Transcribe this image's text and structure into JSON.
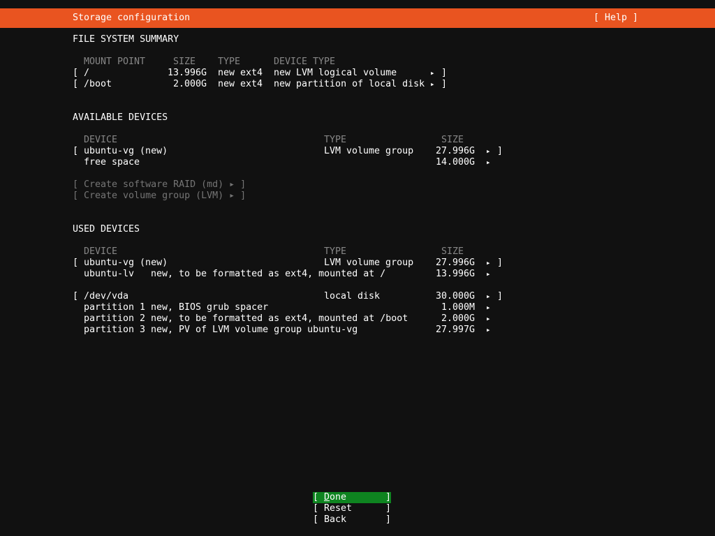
{
  "glyphs": {
    "open_bracket": "[",
    "close_bracket": "]",
    "arrow": "▸"
  },
  "colors": {
    "accent_orange": "#E95420",
    "focus_green": "#0E8420",
    "background": "#111111",
    "muted_gray": "#878787"
  },
  "header": {
    "title": "Storage configuration",
    "help_label": "[ Help ]"
  },
  "fs": {
    "title": "FILE SYSTEM SUMMARY",
    "columns": [
      "MOUNT POINT",
      "SIZE",
      "TYPE",
      "DEVICE TYPE"
    ],
    "rows": [
      {
        "mount_point": "/",
        "size": "13.996G",
        "type": "new ext4",
        "device_type": "new LVM logical volume"
      },
      {
        "mount_point": "/boot",
        "size": "2.000G",
        "type": "new ext4",
        "device_type": "new partition of local disk"
      }
    ]
  },
  "available": {
    "title": "AVAILABLE DEVICES",
    "columns": [
      "DEVICE",
      "TYPE",
      "SIZE"
    ],
    "rows": [
      {
        "device": "ubuntu-vg (new)",
        "type": "LVM volume group",
        "size": "27.996G"
      },
      {
        "device": "free space",
        "size": "14.000G"
      }
    ],
    "actions": [
      "[ Create software RAID (md) ▸ ]",
      "[ Create volume group (LVM) ▸ ]"
    ]
  },
  "used": {
    "title": "USED DEVICES",
    "columns": [
      "DEVICE",
      "TYPE",
      "SIZE"
    ],
    "groups": [
      {
        "rows": [
          {
            "device": "ubuntu-vg (new)",
            "type": "LVM volume group",
            "size": "27.996G"
          },
          {
            "device": "ubuntu-lv",
            "desc": "new, to be formatted as ext4, mounted at /",
            "size": "13.996G"
          }
        ]
      },
      {
        "rows": [
          {
            "device": "/dev/vda",
            "type": "local disk",
            "size": "30.000G"
          },
          {
            "device": "partition 1",
            "desc": "new, BIOS grub spacer",
            "size": "1.000M"
          },
          {
            "device": "partition 2",
            "desc": "new, to be formatted as ext4, mounted at /boot",
            "size": "2.000G"
          },
          {
            "device": "partition 3",
            "desc": "new, PV of LVM volume group ubuntu-vg",
            "size": "27.997G"
          }
        ]
      }
    ]
  },
  "footer": {
    "buttons": [
      {
        "label": "Done"
      },
      {
        "label": "Reset"
      },
      {
        "label": "Back"
      }
    ]
  }
}
